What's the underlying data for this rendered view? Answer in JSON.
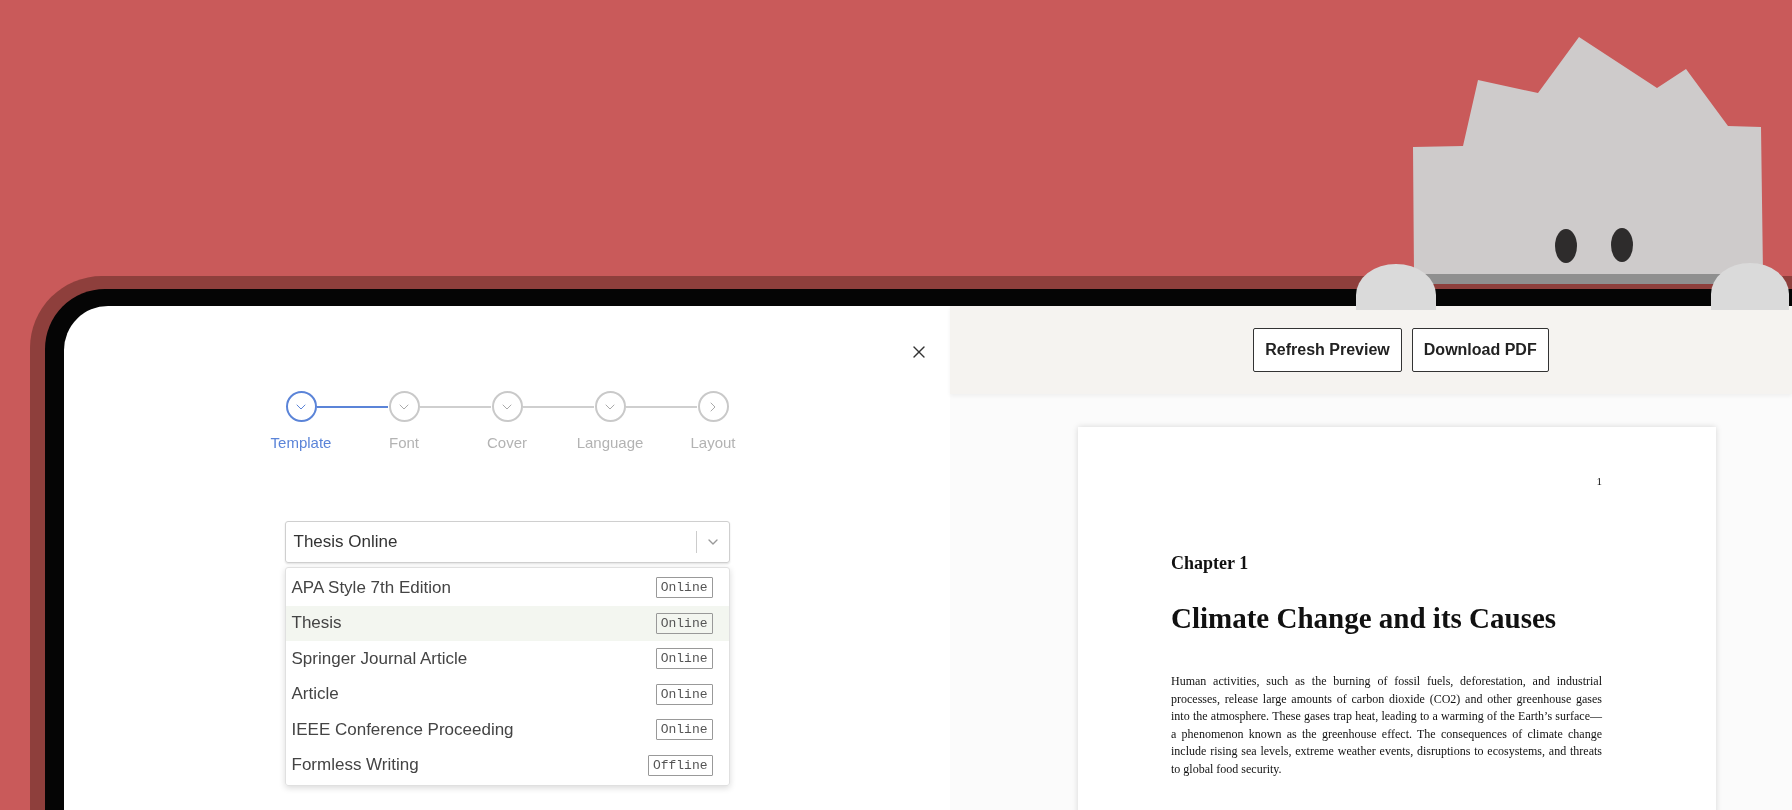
{
  "editor": {
    "steps": [
      {
        "label": "Template",
        "selected": true
      },
      {
        "label": "Font",
        "selected": false
      },
      {
        "label": "Cover",
        "selected": false
      },
      {
        "label": "Language",
        "selected": false
      },
      {
        "label": "Layout",
        "selected": false
      }
    ],
    "template_select": {
      "value": "Thesis Online",
      "options": [
        {
          "label": "APA Style 7th Edition",
          "badge": "Online",
          "selected": false
        },
        {
          "label": "Thesis",
          "badge": "Online",
          "selected": true
        },
        {
          "label": "Springer Journal Article",
          "badge": "Online",
          "selected": false
        },
        {
          "label": "Article",
          "badge": "Online",
          "selected": false
        },
        {
          "label": "IEEE Conference Proceeding",
          "badge": "Online",
          "selected": false
        },
        {
          "label": "Formless Writing",
          "badge": "Offline",
          "selected": false
        }
      ]
    }
  },
  "preview": {
    "buttons": [
      "Refresh Preview",
      "Download PDF"
    ],
    "page": {
      "page_number": "1",
      "chapter": "Chapter 1",
      "title": "Climate Change and its Causes",
      "paragraph": "Human activities, such as the burning of fossil fuels, deforestation, and industrial processes, release large amounts of carbon dioxide (CO2) and other greenhouse gases into the atmosphere.  These gases trap heat, leading to a warming of the Earth’s surface—a phenomenon known as the greenhouse effect.  The consequences of climate change include rising sea levels, extreme weather events, disruptions to ecosystems, and threats to global food security."
    }
  }
}
